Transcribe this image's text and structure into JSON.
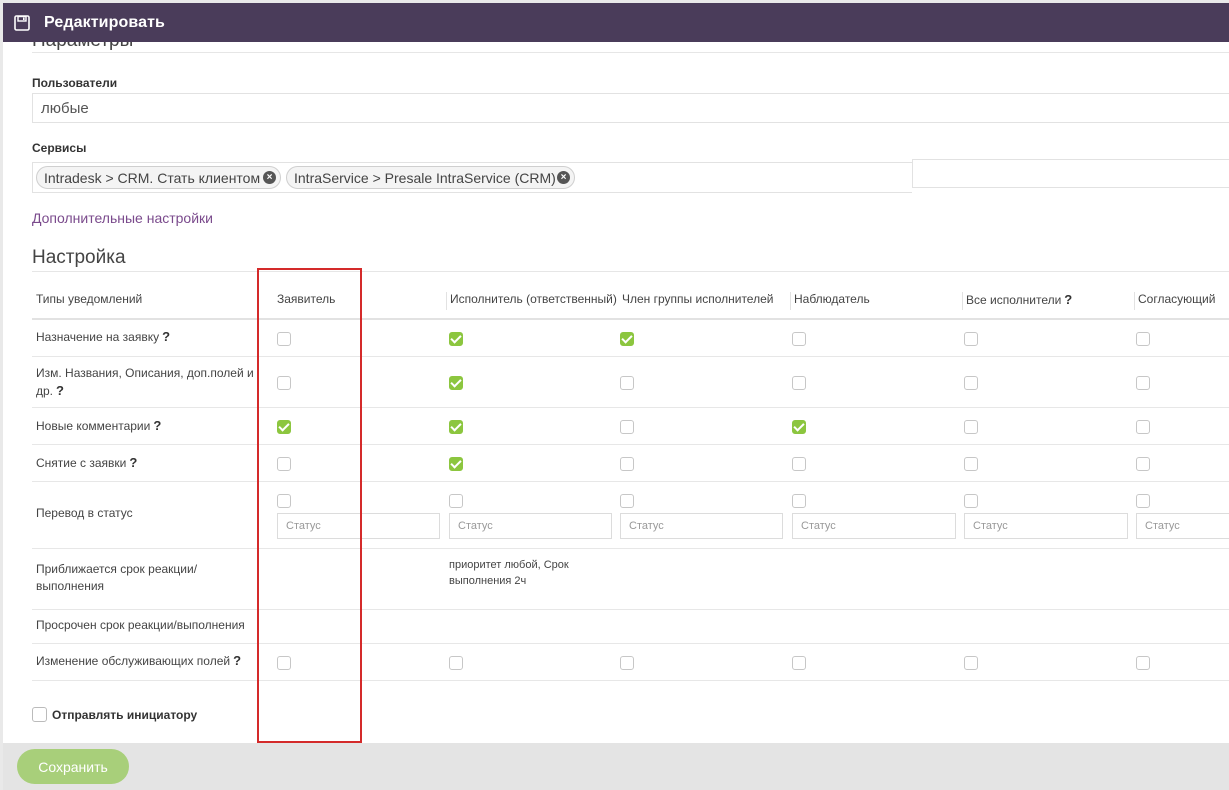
{
  "window": {
    "title": "Редактировать"
  },
  "params_title": "Параметры",
  "users": {
    "label": "Пользователи",
    "value": "любые"
  },
  "services": {
    "label": "Сервисы",
    "tags": [
      "Intradesk > CRM. Стать клиентом",
      "IntraService > Presale IntraService (CRM)"
    ]
  },
  "extra_settings_link": "Дополнительные настройки",
  "settings_title": "Настройка",
  "table": {
    "columns": [
      "Типы уведомлений",
      "Заявитель",
      "Исполнитель (ответственный)",
      "Член группы исполнителей",
      "Наблюдатель",
      "Все исполнители",
      "Согласующий"
    ],
    "status_placeholder": "Статус",
    "rows": [
      {
        "label": "Назначение на заявку",
        "checks": [
          false,
          true,
          true,
          false,
          false,
          false
        ]
      },
      {
        "label": "Изм. Названия, Описания, доп.полей и др.",
        "checks": [
          false,
          true,
          false,
          false,
          false,
          false
        ]
      },
      {
        "label": "Новые комментарии",
        "checks": [
          true,
          true,
          false,
          true,
          false,
          false
        ]
      },
      {
        "label": "Снятие с заявки",
        "checks": [
          false,
          true,
          false,
          false,
          false,
          false
        ]
      },
      {
        "label": "Перевод в статус",
        "checks": [
          false,
          false,
          false,
          false,
          false,
          false
        ]
      },
      {
        "label": "Приближается срок реакции/выполнения",
        "info": "приоритет любой,  Срок выполнения   2ч"
      },
      {
        "label": "Просрочен срок реакции/выполнения"
      },
      {
        "label": "Изменение обслуживающих полей",
        "checks": [
          false,
          false,
          false,
          false,
          false,
          false
        ]
      }
    ]
  },
  "send_initiator": {
    "label": "Отправлять инициатору",
    "checked": false
  },
  "save_button": "Сохранить",
  "colors": {
    "titlebar": "#4a3c5a",
    "check_on": "#8cc63f",
    "link": "#7a4a8c",
    "highlight": "#d42a2a",
    "save": "#a8cf7a"
  },
  "icons": {
    "title": "floppy-disk-icon",
    "tag_remove": "circle-x-icon",
    "help": "question-mark-icon"
  }
}
